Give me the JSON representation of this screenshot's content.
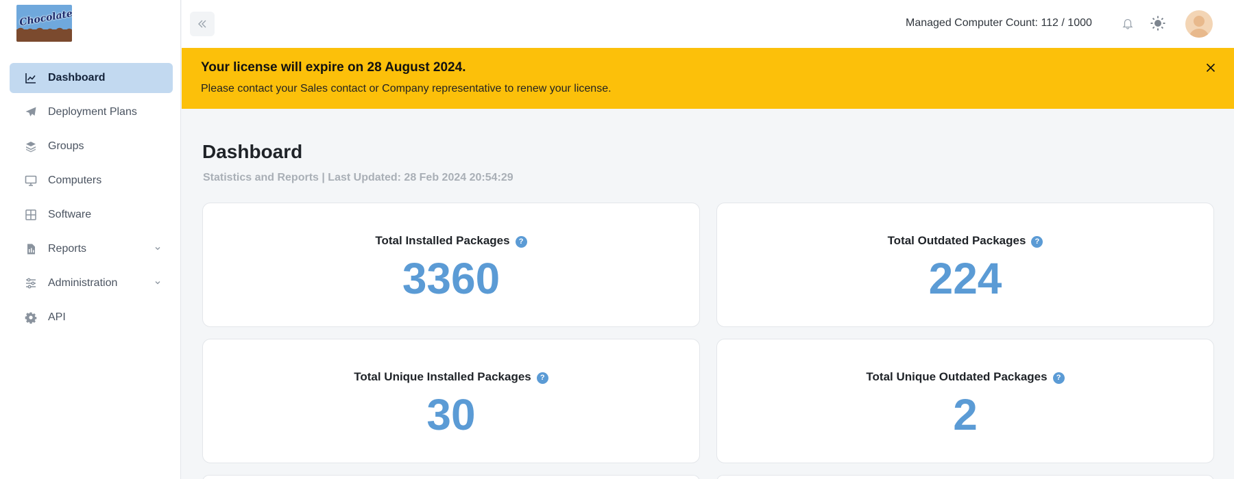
{
  "logo": {
    "text": "Chocolatey"
  },
  "sidebar": {
    "items": [
      {
        "label": "Dashboard",
        "icon": "chart-line-icon",
        "active": true
      },
      {
        "label": "Deployment Plans",
        "icon": "paper-plane-icon"
      },
      {
        "label": "Groups",
        "icon": "layers-icon"
      },
      {
        "label": "Computers",
        "icon": "monitor-icon"
      },
      {
        "label": "Software",
        "icon": "grid-icon"
      },
      {
        "label": "Reports",
        "icon": "report-file-icon",
        "expandable": true
      },
      {
        "label": "Administration",
        "icon": "sliders-icon",
        "expandable": true
      },
      {
        "label": "API",
        "icon": "gear-icon"
      }
    ]
  },
  "header": {
    "computer_count": "Managed Computer Count: 112 / 1000"
  },
  "banner": {
    "title": "Your license will expire on 28 August 2024.",
    "text": "Please contact your Sales contact or Company representative to renew your license."
  },
  "main": {
    "title": "Dashboard",
    "subtitle": "Statistics and Reports | Last Updated: 28 Feb 2024 20:54:29",
    "cards": [
      {
        "label": "Total Installed Packages",
        "value": "3360"
      },
      {
        "label": "Total Outdated Packages",
        "value": "224"
      },
      {
        "label": "Total Unique Installed Packages",
        "value": "30"
      },
      {
        "label": "Total Unique Outdated Packages",
        "value": "2"
      }
    ]
  },
  "colors": {
    "accent": "#5b9bd5",
    "banner": "#fcc00a",
    "active_nav": "#c2d9f0"
  }
}
